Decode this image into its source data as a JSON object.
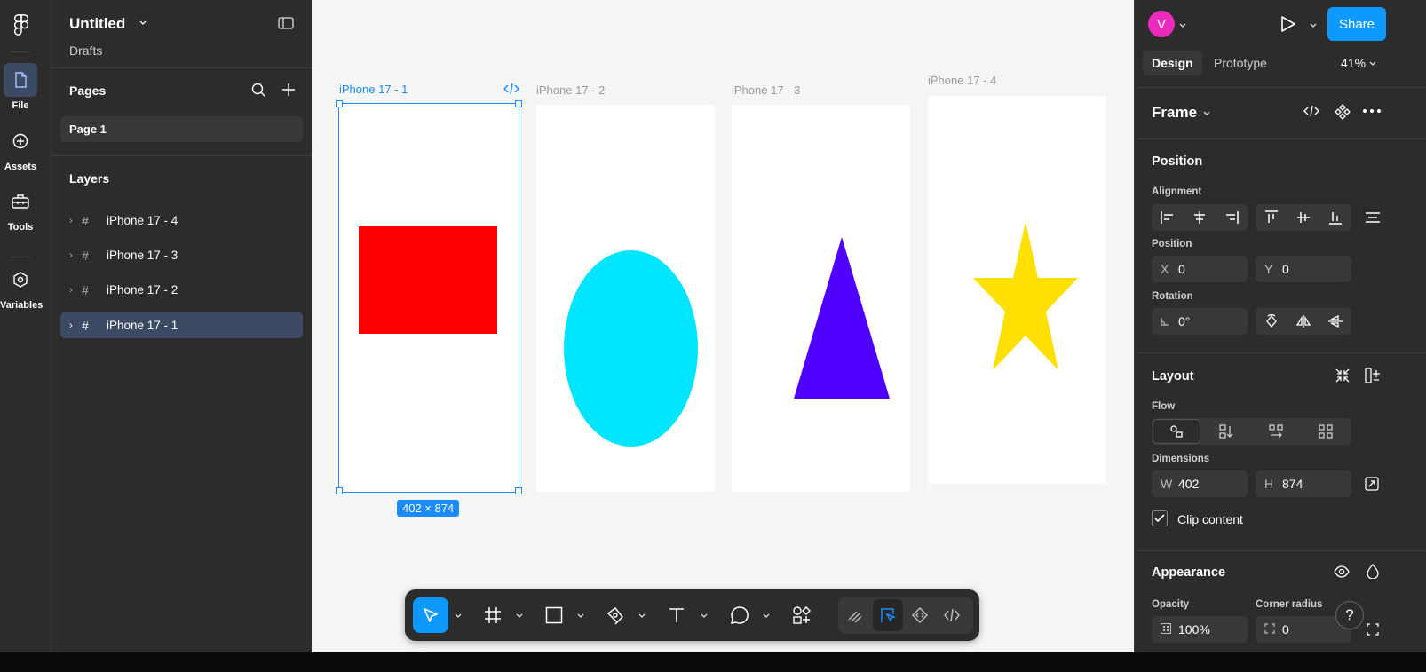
{
  "app": {
    "file_title": "Untitled",
    "file_location": "Drafts"
  },
  "rail": [
    {
      "label": "File",
      "icon": "file-icon",
      "active": true
    },
    {
      "label": "Assets",
      "icon": "assets-icon",
      "active": false
    },
    {
      "label": "Tools",
      "icon": "toolbox-icon",
      "active": false
    },
    {
      "label": "Variables",
      "icon": "variables-icon",
      "active": false
    }
  ],
  "pages": {
    "title": "Pages",
    "items": [
      {
        "label": "Page 1"
      }
    ]
  },
  "layers": {
    "title": "Layers",
    "items": [
      {
        "label": "iPhone 17 - 4"
      },
      {
        "label": "iPhone 17 - 3"
      },
      {
        "label": "iPhone 17 - 2"
      },
      {
        "label": "iPhone 17 - 1",
        "selected": true
      }
    ]
  },
  "canvas": {
    "frames": [
      {
        "label": "iPhone 17 - 1",
        "shape": "rectangle",
        "color": "#ff0000",
        "selected": true
      },
      {
        "label": "iPhone 17 - 2",
        "shape": "ellipse",
        "color": "#00e5ff"
      },
      {
        "label": "iPhone 17 - 3",
        "shape": "triangle",
        "color": "#5000ff"
      },
      {
        "label": "iPhone 17 - 4",
        "shape": "star",
        "color": "#ffe000"
      }
    ],
    "selection_dimensions": "402 × 874"
  },
  "toolbar": {
    "tools": [
      "move-tool",
      "frame-tool",
      "rectangle-tool",
      "pen-tool",
      "text-tool",
      "comment-tool",
      "actions-tool"
    ],
    "modes": [
      "draw-mode",
      "design-mode",
      "dev-components-mode",
      "dev-mode"
    ]
  },
  "right_panel": {
    "avatar_initial": "V",
    "share_label": "Share",
    "tabs": [
      "Design",
      "Prototype"
    ],
    "zoom": "41%",
    "frame_label": "Frame",
    "position_title": "Position",
    "alignment_label": "Alignment",
    "position_label": "Position",
    "x_prefix": "X",
    "x_value": "0",
    "y_prefix": "Y",
    "y_value": "0",
    "rotation_label": "Rotation",
    "rotation_value": "0°",
    "layout_title": "Layout",
    "flow_label": "Flow",
    "dimensions_label": "Dimensions",
    "w_prefix": "W",
    "w_value": "402",
    "h_prefix": "H",
    "h_value": "874",
    "clip_content_label": "Clip content",
    "clip_content_checked": true,
    "appearance_title": "Appearance",
    "opacity_label": "Opacity",
    "opacity_value": "100%",
    "corner_radius_label": "Corner radius",
    "corner_radius_value": "0",
    "help_label": "?"
  },
  "colors": {
    "accent": "#0d99ff",
    "selection": "#1a8cff",
    "panel": "#2c2c2c",
    "avatar": "#ec2bbd"
  }
}
